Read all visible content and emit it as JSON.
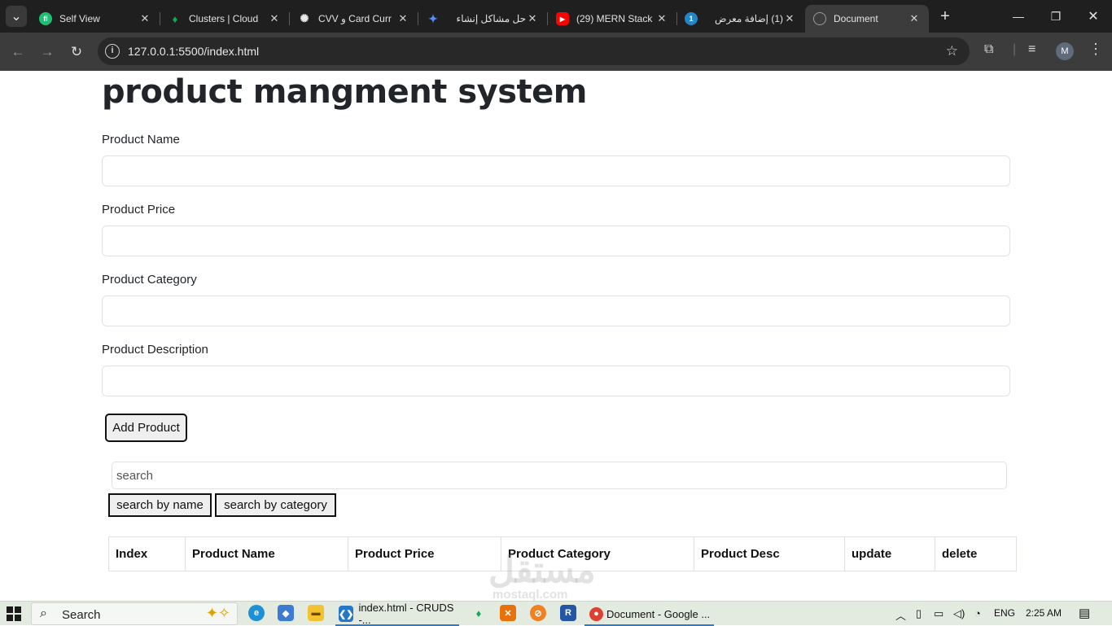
{
  "browser": {
    "tabs": [
      {
        "title": "Self View",
        "icon": "fiverr-icon",
        "color": "#1dbf73",
        "glyph": "fi"
      },
      {
        "title": "Clusters | Cloud",
        "icon": "mongodb-leaf-icon",
        "color": "#1f1f1f",
        "glyph": "●"
      },
      {
        "title": "CVV و Card Curr",
        "icon": "openai-icon",
        "color": "#1f1f1f",
        "glyph": "✺"
      },
      {
        "title": "حل مشاكل إنشاء",
        "icon": "gemini-icon",
        "color": "#1f1f1f",
        "glyph": "✦"
      },
      {
        "title": "(29) MERN Stack",
        "icon": "youtube-icon",
        "color": "#ff0000",
        "glyph": "▶"
      },
      {
        "title": "(1) إضافة معرض",
        "icon": "mostaql-icon",
        "color": "#2386c8",
        "glyph": "1"
      },
      {
        "title": "Document",
        "icon": "globe-icon",
        "color": "#8a8a8a",
        "glyph": "◎"
      }
    ],
    "url": "127.0.0.1:5500/index.html",
    "profile_initial": "M"
  },
  "page": {
    "title": "product mangment system",
    "fields": [
      {
        "label": "Product Name",
        "value": ""
      },
      {
        "label": "Product Price",
        "value": ""
      },
      {
        "label": "Product Category",
        "value": ""
      },
      {
        "label": "Product Description",
        "value": ""
      }
    ],
    "add_button": "Add Product",
    "search_placeholder": "search",
    "search_by_name": "search by name",
    "search_by_category": "search by category",
    "table_headers": [
      "Index",
      "Product Name",
      "Product Price",
      "Product Category",
      "Product Desc",
      "update",
      "delete"
    ]
  },
  "watermark": {
    "logo_text": "مستقل",
    "site": "mostaql.com"
  },
  "taskbar": {
    "search_label": "Search",
    "tasks": [
      {
        "label": "index.html - CRUDS -...",
        "icon": "vscode-icon"
      },
      {
        "label": "Document - Google ...",
        "icon": "chrome-icon"
      }
    ],
    "language": "ENG",
    "time": "2:25 AM"
  }
}
